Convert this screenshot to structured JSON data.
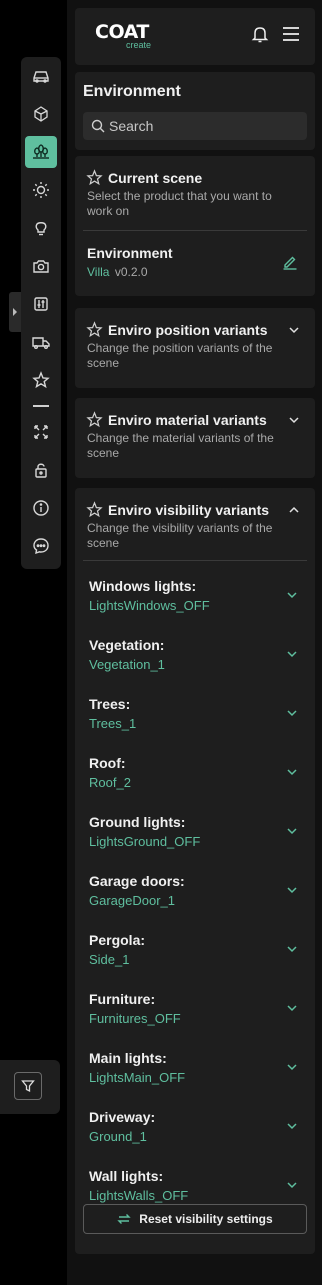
{
  "logo": {
    "main": "COAT",
    "sub": "create"
  },
  "environment": {
    "title": "Environment",
    "search_placeholder": "Search"
  },
  "current_scene": {
    "title": "Current scene",
    "description": "Select the product that you want to work on",
    "name": "Environment",
    "variant": "Villa",
    "version": "v0.2.0"
  },
  "position_variants": {
    "title": "Enviro position variants",
    "description": "Change the position variants of the scene"
  },
  "material_variants": {
    "title": "Enviro material variants",
    "description": "Change the material variants of the scene"
  },
  "visibility_variants": {
    "title": "Enviro visibility variants",
    "description": "Change the visibility variants of the scene",
    "items": [
      {
        "label": "Windows lights:",
        "value": "LightsWindows_OFF"
      },
      {
        "label": "Vegetation:",
        "value": "Vegetation_1"
      },
      {
        "label": "Trees:",
        "value": "Trees_1"
      },
      {
        "label": "Roof:",
        "value": "Roof_2"
      },
      {
        "label": "Ground lights:",
        "value": "LightsGround_OFF"
      },
      {
        "label": "Garage doors:",
        "value": "GarageDoor_1"
      },
      {
        "label": "Pergola:",
        "value": "Side_1"
      },
      {
        "label": "Furniture:",
        "value": "Furnitures_OFF"
      },
      {
        "label": "Main lights:",
        "value": "LightsMain_OFF"
      },
      {
        "label": "Driveway:",
        "value": "Ground_1"
      },
      {
        "label": "Wall lights:",
        "value": "LightsWalls_OFF"
      }
    ],
    "reset_label": "Reset visibility settings"
  },
  "toolbar_icons": [
    "car-icon",
    "cube-icon",
    "forest-icon",
    "sun-icon",
    "lightbulb-icon",
    "camera-icon",
    "sliders-icon",
    "vehicle-icon",
    "star-icon",
    "separator",
    "expand-icon",
    "unlock-icon",
    "info-icon",
    "chat-icon"
  ],
  "colors": {
    "accent": "#5fbf9f",
    "panel_bg": "#1e1e1e",
    "app_bg": "#111111"
  }
}
